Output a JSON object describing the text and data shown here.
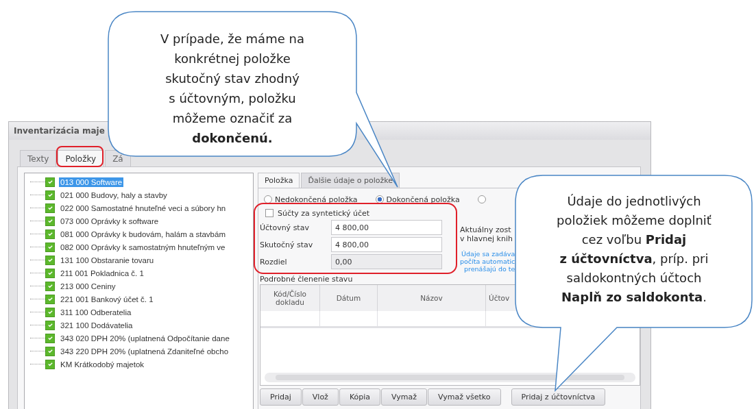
{
  "window": {
    "title": "Inventarizácia maje"
  },
  "tabs": [
    {
      "label": "Texty",
      "selected": false
    },
    {
      "label": "Položky",
      "selected": true
    },
    {
      "label": "Zá",
      "selected": false
    }
  ],
  "tree": {
    "items": [
      {
        "label": "013 000 Software",
        "checked": true,
        "selected": true
      },
      {
        "label": "021 000 Budovy, haly a stavby",
        "checked": true,
        "selected": false
      },
      {
        "label": "022 000 Samostatné hnuteľné veci a súbory hn",
        "checked": true,
        "selected": false
      },
      {
        "label": "073 000 Oprávky k software",
        "checked": true,
        "selected": false
      },
      {
        "label": "081 000 Oprávky k budovám, halám a stavbám",
        "checked": true,
        "selected": false
      },
      {
        "label": "082 000 Oprávky k samostatným hnuteľným ve",
        "checked": true,
        "selected": false
      },
      {
        "label": "131 100 Obstaranie tovaru",
        "checked": true,
        "selected": false
      },
      {
        "label": "211 001 Pokladnica č. 1",
        "checked": true,
        "selected": false
      },
      {
        "label": "213 000 Ceniny",
        "checked": true,
        "selected": false
      },
      {
        "label": "221 001 Bankový účet č. 1",
        "checked": true,
        "selected": false
      },
      {
        "label": "311 100 Odberatelia",
        "checked": true,
        "selected": false
      },
      {
        "label": "321 100 Dodávatelia",
        "checked": true,
        "selected": false
      },
      {
        "label": "343 020 DPH 20% (uplatnená Odpočítanie dane",
        "checked": true,
        "selected": false
      },
      {
        "label": "343 220 DPH 20% (uplatnená Zdaniteľné obcho",
        "checked": true,
        "selected": false
      },
      {
        "label": "KM  Krátkodobý majetok",
        "checked": true,
        "selected": false
      }
    ]
  },
  "detail_tabs": [
    {
      "label": "Položka",
      "selected": true
    },
    {
      "label": "Ďalšie údaje o položke",
      "selected": false
    }
  ],
  "radios": [
    {
      "label": "Nedokončená položka",
      "selected": false
    },
    {
      "label": "Dokončená položka",
      "selected": true
    },
    {
      "selected": false
    }
  ],
  "sum_checkbox": {
    "label": "Súčty za syntetický účet",
    "checked": false
  },
  "fields": [
    {
      "label": "Účtovný stav",
      "value": "4 800,00",
      "disabled": false
    },
    {
      "label": "Skutočný stav",
      "value": "4 800,00",
      "disabled": false
    },
    {
      "label": "Rozdiel",
      "value": "0,00",
      "disabled": true
    }
  ],
  "info_text": [
    "Aktuálny zost",
    "v hlavnej knih"
  ],
  "hint_text": [
    "Údaje sa zadáva",
    "počíta automatic",
    "prenášajú do te"
  ],
  "breakdown": {
    "title": "Podrobné členenie stavu",
    "columns": [
      "Kód/Číslo dokladu",
      "Dátum",
      "Názov",
      "Účtov"
    ]
  },
  "buttons": [
    "Pridaj",
    "Vlož",
    "Kópia",
    "Vymaž",
    "Vymaž všetko",
    "Pridaj z účtovníctva"
  ],
  "callouts": [
    "V prípade, že máme na\nkonkrétnej položke\nskutočný stav zhodný\ns účtovným, položku\nmôžeme označiť za\n**dokončenú.**",
    "Údaje do jednotlivých\npoložiek môžeme doplniť\ncez voľbu **Pridaj**\n**z účtovníctva**, príp. pri\nsaldokontných účtoch\n**Naplň zo saldokonta**."
  ]
}
